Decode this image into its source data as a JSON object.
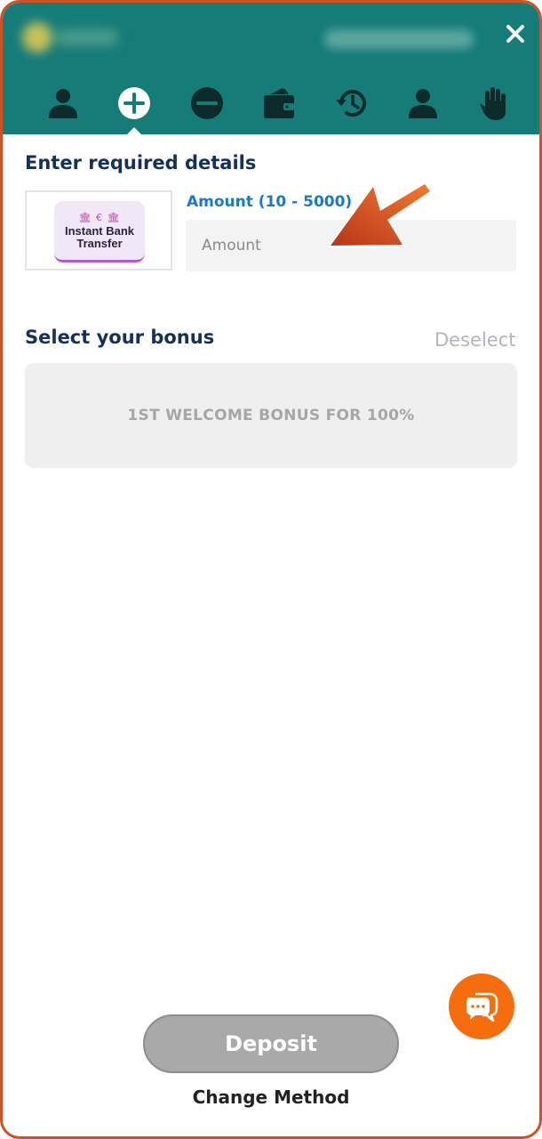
{
  "header": {
    "close_icon": "close-icon",
    "nav_items": [
      {
        "icon": "profile-icon"
      },
      {
        "icon": "deposit-plus-icon",
        "active": true
      },
      {
        "icon": "withdraw-minus-icon"
      },
      {
        "icon": "wallet-icon"
      },
      {
        "icon": "history-icon"
      },
      {
        "icon": "account-icon"
      },
      {
        "icon": "responsible-gaming-hand-icon"
      }
    ],
    "background_color": "#157c78"
  },
  "details": {
    "title": "Enter required details",
    "method": {
      "logo_line1": "Instant Bank",
      "logo_line2": "Transfer",
      "logo_symbol": "€"
    },
    "amount_label": "Amount (10 - 5000)",
    "amount_placeholder": "Amount",
    "amount_value": ""
  },
  "bonus": {
    "title": "Select your bonus",
    "deselect_label": "Deselect",
    "options": [
      {
        "label": "1ST WELCOME BONUS FOR 100%"
      }
    ]
  },
  "footer": {
    "deposit_label": "Deposit",
    "change_method_label": "Change Method",
    "chat_icon": "chat-icon"
  },
  "colors": {
    "accent_orange": "#f56d0d",
    "title_navy": "#14315e",
    "label_blue": "#1a78d0",
    "frame_border": "#cf5125"
  }
}
